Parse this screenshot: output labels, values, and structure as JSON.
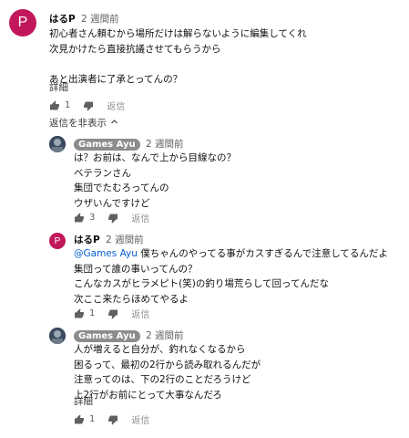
{
  "top": {
    "avatar_letter": "P",
    "author": "はるP",
    "time": "2 週間前",
    "lines": [
      "初心者さん頼むから場所だけは解らないように編集してくれ",
      "次見かけたら直接抗議させてもらうから",
      "",
      "あと出演者に了承とってんの？"
    ],
    "more": "詳細",
    "likes": "1",
    "reply": "返信"
  },
  "hide_replies": "返信を非表示",
  "replies": [
    {
      "author": "Games Ayu",
      "time": "2 週間前",
      "lines": [
        "は？お前は、なんで上から目線なの？",
        "ベテランさん",
        "集団でたむろってんの",
        "ウザいんですけど"
      ],
      "likes": "3",
      "reply": "返信"
    },
    {
      "avatar_letter": "P",
      "author": "はるP",
      "time": "2 週間前",
      "mention": "@Games Ayu",
      "lines": [
        "僕ちゃんのやってる事がカスすぎるんで注意してるんだよ",
        "集団って誰の事いってんの？",
        "こんなカスがヒラメピト(笑)の釣り場荒らして回ってんだな",
        "次ここ来たらほめてやるよ"
      ],
      "likes": "1",
      "reply": "返信"
    },
    {
      "author": "Games Ayu",
      "time": "2 週間前",
      "lines": [
        "人が増えると自分が、釣れなくなるから",
        "困るって、最初の2行から読み取れるんだが",
        "注意ってのは、下の2行のことだろうけど",
        "上2行がお前にとって大事なんだろ"
      ],
      "more": "詳細",
      "likes": "1",
      "reply": "返信"
    }
  ]
}
